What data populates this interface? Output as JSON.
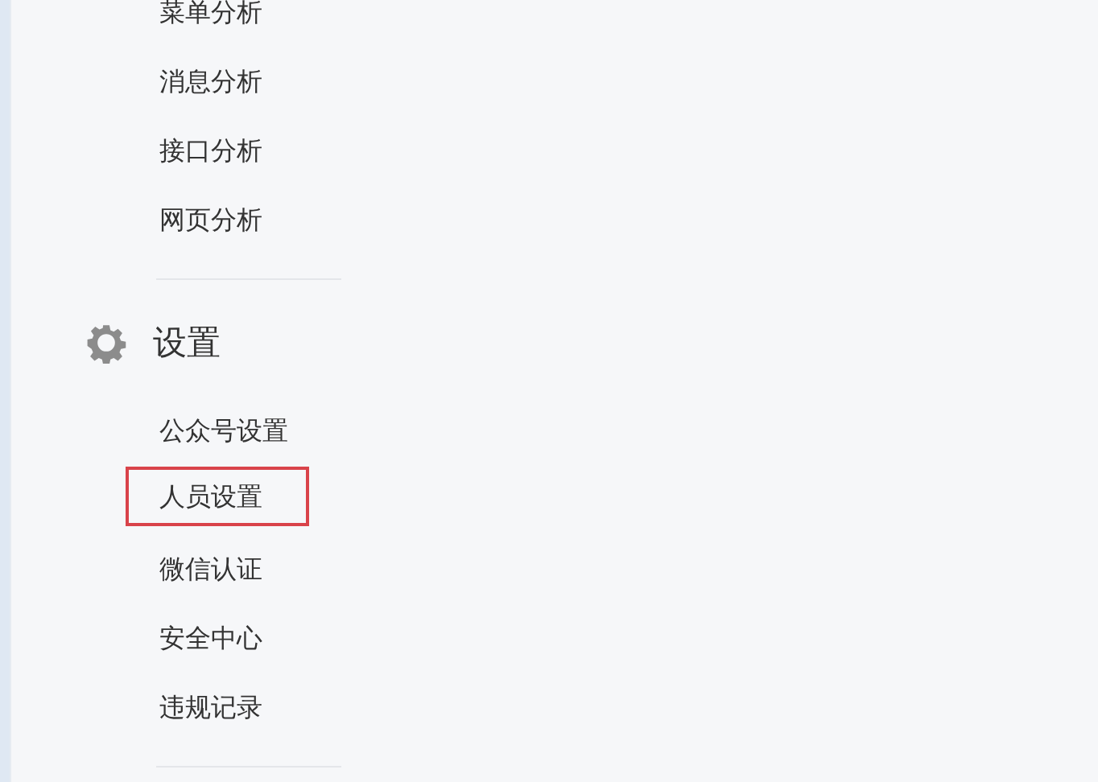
{
  "sections": [
    {
      "items": [
        {
          "label": "菜单分析",
          "highlighted": false
        },
        {
          "label": "消息分析",
          "highlighted": false
        },
        {
          "label": "接口分析",
          "highlighted": false
        },
        {
          "label": "网页分析",
          "highlighted": false
        }
      ]
    },
    {
      "heading": "设置",
      "items": [
        {
          "label": "公众号设置",
          "highlighted": false
        },
        {
          "label": "人员设置",
          "highlighted": true
        },
        {
          "label": "微信认证",
          "highlighted": false
        },
        {
          "label": "安全中心",
          "highlighted": false
        },
        {
          "label": "违规记录",
          "highlighted": false
        }
      ]
    }
  ]
}
